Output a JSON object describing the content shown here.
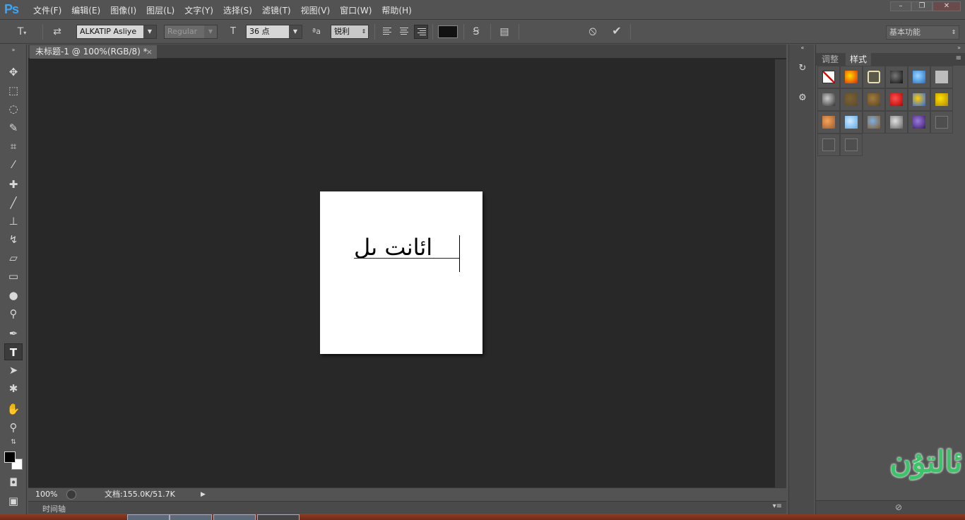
{
  "app": {
    "logo": "Ps"
  },
  "menu": [
    "文件(F)",
    "编辑(E)",
    "图像(I)",
    "图层(L)",
    "文字(Y)",
    "选择(S)",
    "滤镜(T)",
    "视图(V)",
    "窗口(W)",
    "帮助(H)"
  ],
  "window_controls": {
    "minimize": "–",
    "restore": "❐",
    "close": "✕"
  },
  "options": {
    "font_family": "ALKATIP Asliye",
    "font_style": "Regular",
    "font_size": "36 点",
    "aa_label": "ªa",
    "antialias": "锐利",
    "color": "#111111",
    "cancel_icon": "⦸",
    "commit_icon": "✔",
    "workspace": "基本功能"
  },
  "document": {
    "tab_title": "未标题-1 @ 100%(RGB/8) *",
    "close": "×",
    "canvas_text": "ائانت ىل",
    "canvas_bg": "#ffffff"
  },
  "status": {
    "zoom": "100%",
    "info": "文档:155.0K/51.7K",
    "arrow": "▶"
  },
  "timeline": {
    "label": "时间轴"
  },
  "panel": {
    "tabs": [
      "调整",
      "样式"
    ],
    "active_tab": "样式",
    "styles": [
      {
        "name": "none-style",
        "colors": [
          "#ffffff",
          "#ff0000"
        ]
      },
      {
        "name": "red-glow-style",
        "colors": [
          "#ffdd00",
          "#e02000"
        ]
      },
      {
        "name": "outline-style",
        "colors": [
          "#5a5a4a",
          "#e8e0b0"
        ]
      },
      {
        "name": "dark-bevel-style",
        "colors": [
          "#777777",
          "#111111"
        ]
      },
      {
        "name": "blue-glass-style",
        "colors": [
          "#9fd6ff",
          "#1a6fc8"
        ]
      },
      {
        "name": "gray-flat-style",
        "colors": [
          "#bdbdbd",
          "#bdbdbd"
        ]
      },
      {
        "name": "chrome-style",
        "colors": [
          "#cccccc",
          "#333333"
        ]
      },
      {
        "name": "bronze-style",
        "colors": [
          "#7a6236",
          "#5e4a26"
        ]
      },
      {
        "name": "wood-style",
        "colors": [
          "#a07d40",
          "#5c4420"
        ]
      },
      {
        "name": "red-button-style",
        "colors": [
          "#ff5050",
          "#b00000"
        ]
      },
      {
        "name": "rainbow-style",
        "colors": [
          "#ffcc00",
          "#2266ff"
        ]
      },
      {
        "name": "gold-style",
        "colors": [
          "#ffe000",
          "#b08800"
        ]
      },
      {
        "name": "sunset-style",
        "colors": [
          "#f7a45a",
          "#9a5a30"
        ]
      },
      {
        "name": "sky-style",
        "colors": [
          "#cfe9ff",
          "#5ea8e8"
        ]
      },
      {
        "name": "landscape-style",
        "colors": [
          "#7ab0e8",
          "#8a5a20"
        ]
      },
      {
        "name": "pattern-style",
        "colors": [
          "#e0e0e0",
          "#666666"
        ]
      },
      {
        "name": "purple-style",
        "colors": [
          "#9a7adc",
          "#3a1a6a"
        ]
      },
      {
        "name": "empty-style-1",
        "colors": [
          "#4e4e4e",
          "#4e4e4e"
        ]
      },
      {
        "name": "empty-style-2",
        "colors": [
          "#4e4e4e",
          "#4e4e4e"
        ]
      },
      {
        "name": "empty-style-3",
        "colors": [
          "#4e4e4e",
          "#4e4e4e"
        ]
      }
    ]
  },
  "watermark": "ئالتۇن"
}
